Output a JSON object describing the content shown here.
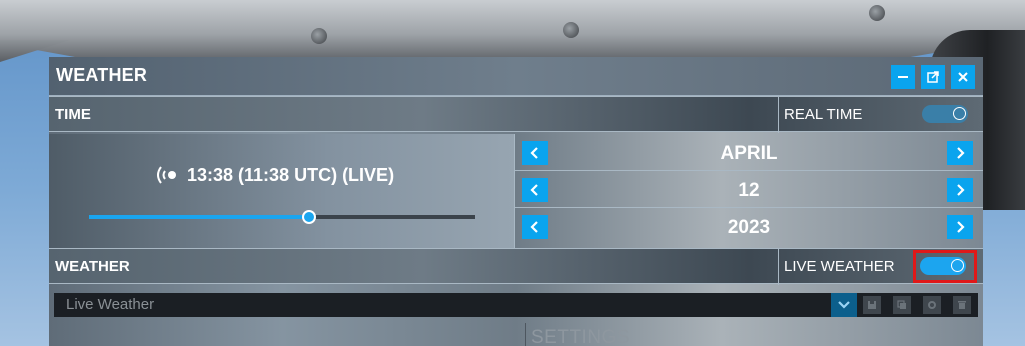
{
  "window": {
    "title": "WEATHER",
    "buttons": {
      "minimize": "minimize-icon",
      "popout": "popout-icon",
      "close": "close-icon"
    }
  },
  "time_section": {
    "label": "TIME",
    "toggle_label": "REAL TIME",
    "toggle_on": true,
    "live_time": "13:38 (11:38 UTC) (LIVE)",
    "time_of_day_slider_fraction": 0.57,
    "month": "APRIL",
    "day": "12",
    "year": "2023"
  },
  "weather_section": {
    "label": "WEATHER",
    "toggle_label": "LIVE WEATHER",
    "toggle_on": true,
    "preset_value": "Live Weather",
    "settings_label": "SETTINGS"
  },
  "colors": {
    "accent": "#0aa4ee",
    "highlight": "#e01818",
    "toggle_off_track": "#3a7fa8",
    "toggle_on_track": "#1ca5ef"
  }
}
